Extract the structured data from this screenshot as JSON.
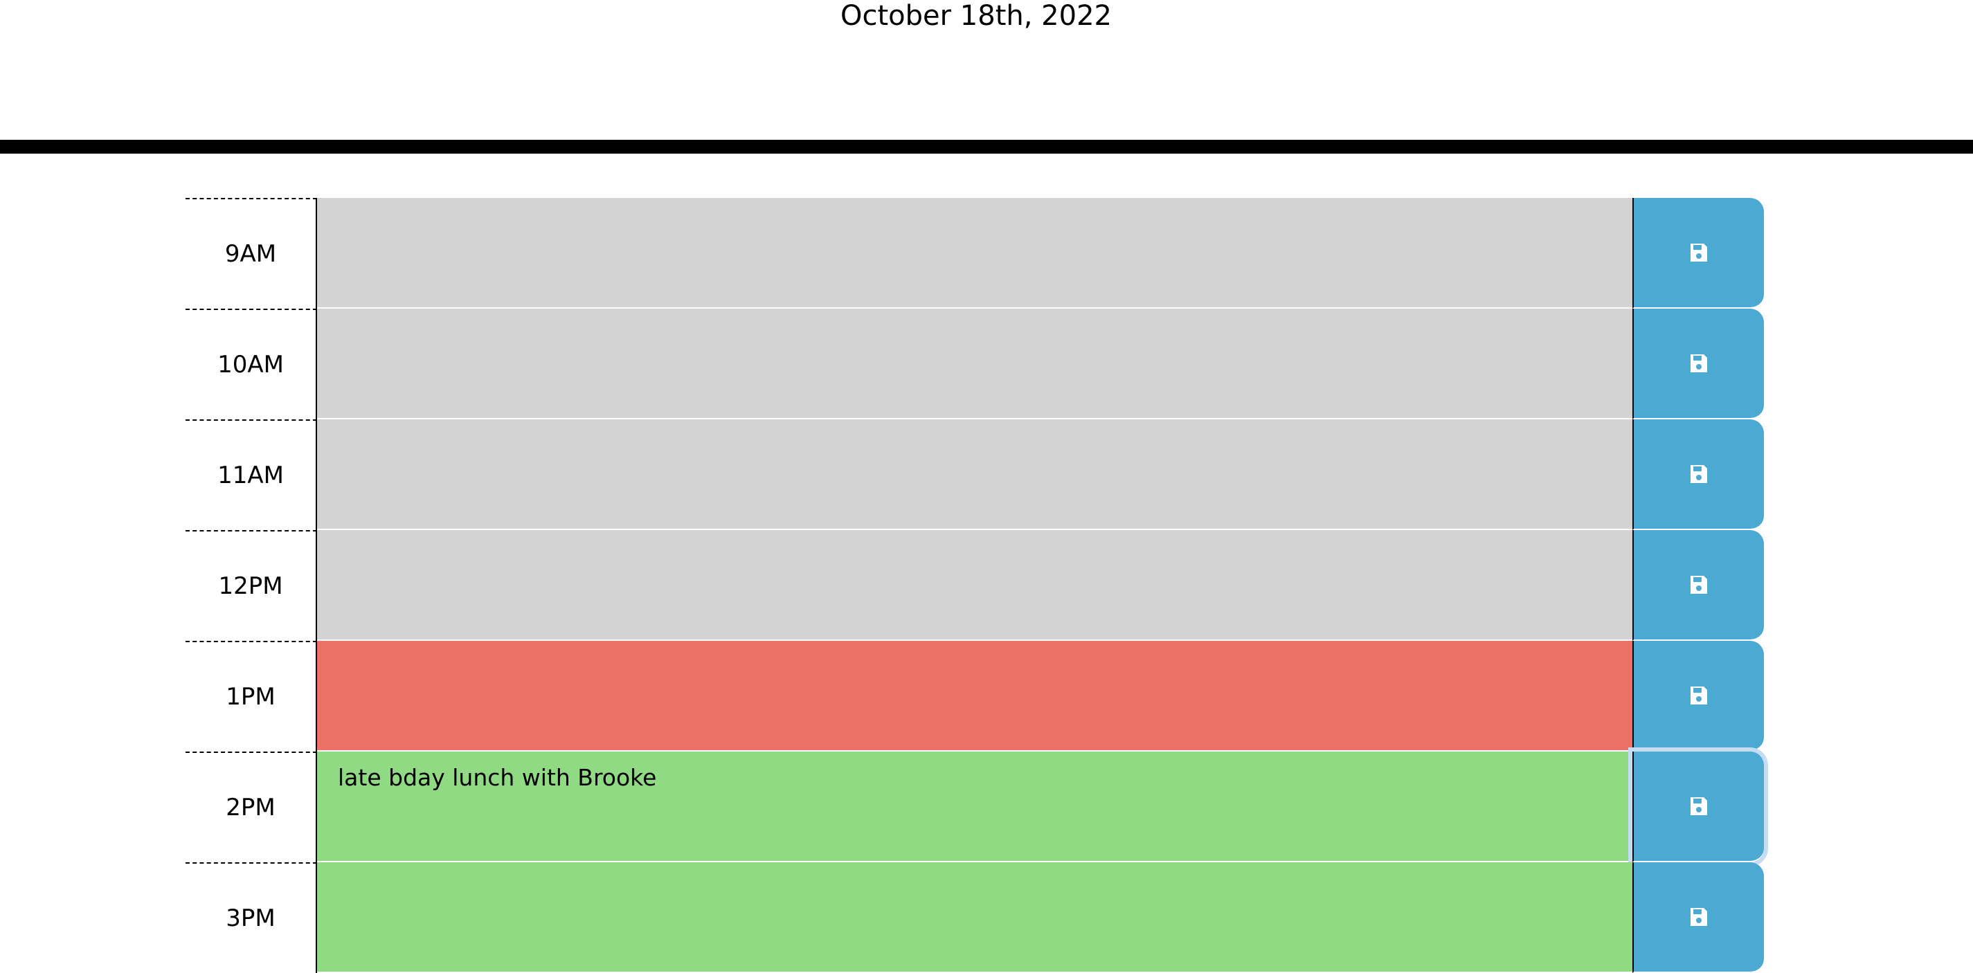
{
  "header": {
    "current_day": "October 18th, 2022"
  },
  "colors": {
    "past": "#d3d3d3",
    "present": "#ec7167",
    "future": "#90da83",
    "save_button": "#4ba9d2"
  },
  "time_blocks": [
    {
      "hour": "9AM",
      "description": "",
      "state": "past",
      "save_icon": "floppy-disk-icon"
    },
    {
      "hour": "10AM",
      "description": "",
      "state": "past",
      "save_icon": "floppy-disk-icon"
    },
    {
      "hour": "11AM",
      "description": "",
      "state": "past",
      "save_icon": "floppy-disk-icon"
    },
    {
      "hour": "12PM",
      "description": "",
      "state": "past",
      "save_icon": "floppy-disk-icon"
    },
    {
      "hour": "1PM",
      "description": "",
      "state": "present",
      "save_icon": "floppy-disk-icon"
    },
    {
      "hour": "2PM",
      "description": "late bday lunch with Brooke",
      "state": "future",
      "save_icon": "floppy-disk-icon"
    },
    {
      "hour": "3PM",
      "description": "",
      "state": "future",
      "save_icon": "floppy-disk-icon"
    }
  ]
}
